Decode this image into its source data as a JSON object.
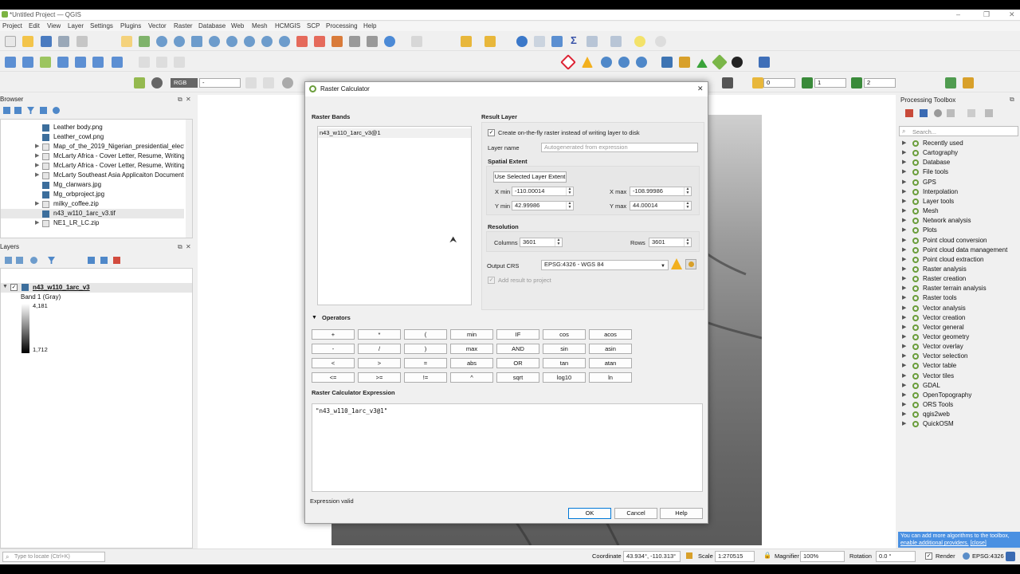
{
  "window": {
    "title": "*Untitled Project — QGIS"
  },
  "menu": [
    "Project",
    "Edit",
    "View",
    "Layer",
    "Settings",
    "Plugins",
    "Vector",
    "Raster",
    "Database",
    "Web",
    "Mesh",
    "HCMGIS",
    "SCP",
    "Processing",
    "Help"
  ],
  "toolbar3": {
    "rgb_label": "RGB",
    "rgb_value": "-",
    "val1": "0",
    "val2": "1",
    "val3": "2"
  },
  "browser": {
    "title": "Browser",
    "items": [
      "Leather body.png",
      "Leather_cowl.png",
      "Map_of_the_2019_Nigerian_presidential_electio",
      "McLarty Africa - Cover Letter, Resume, Writing",
      "McLarty Africa - Cover Letter, Resume, Writing",
      "McLarty Southeast Asia Applicaiton Document",
      "Mg_clanwars.jpg",
      "Mg_orbproject.jpg",
      "milky_coffee.zip",
      "n43_w110_1arc_v3.tif",
      "NE1_LR_LC.zip"
    ]
  },
  "layers": {
    "title": "Layers",
    "layer_name": "n43_w110_1arc_v3",
    "band": "Band 1 (Gray)",
    "max": "4,181",
    "min": "1,712"
  },
  "toolbox": {
    "title": "Processing Toolbox",
    "search_placeholder": "Search...",
    "items": [
      "Recently used",
      "Cartography",
      "Database",
      "File tools",
      "GPS",
      "Interpolation",
      "Layer tools",
      "Mesh",
      "Network analysis",
      "Plots",
      "Point cloud conversion",
      "Point cloud data management",
      "Point cloud extraction",
      "Raster analysis",
      "Raster creation",
      "Raster terrain analysis",
      "Raster tools",
      "Vector analysis",
      "Vector creation",
      "Vector general",
      "Vector geometry",
      "Vector overlay",
      "Vector selection",
      "Vector table",
      "Vector tiles",
      "GDAL",
      "OpenTopography",
      "ORS Tools",
      "qgis2web",
      "QuickOSM"
    ],
    "tip": "You can add more algorithms to the toolbox,",
    "tip_link": "enable additional providers.",
    "tip_close": "[close]"
  },
  "dialog": {
    "title": "Raster Calculator",
    "raster_bands_label": "Raster Bands",
    "band_item": "n43_w110_1arc_v3@1",
    "result_layer_label": "Result Layer",
    "onfly_label": "Create on-the-fly raster instead of writing layer to disk",
    "layer_name_label": "Layer name",
    "layer_name_placeholder": "Autogenerated from expression",
    "spatial_extent_label": "Spatial Extent",
    "use_extent_button": "Use Selected Layer Extent",
    "xmin_label": "X min",
    "xmin": "-110.00014",
    "xmax_label": "X max",
    "xmax": "-108.99986",
    "ymin_label": "Y min",
    "ymin": "42.99986",
    "ymax_label": "Y max",
    "ymax": "44.00014",
    "resolution_label": "Resolution",
    "columns_label": "Columns",
    "columns": "3601",
    "rows_label": "Rows",
    "rows": "3601",
    "crs_label": "Output CRS",
    "crs": "EPSG:4326 - WGS 84",
    "add_result_label": "Add result to project",
    "operators_label": "Operators",
    "operators": [
      [
        "+",
        "*",
        "(",
        "min",
        "IF",
        "cos",
        "acos"
      ],
      [
        "-",
        "/",
        ")",
        "max",
        "AND",
        "sin",
        "asin"
      ],
      [
        "<",
        ">",
        "=",
        "abs",
        "OR",
        "tan",
        "atan"
      ],
      [
        "<=",
        ">=",
        "!=",
        "^",
        "sqrt",
        "log10",
        "ln"
      ]
    ],
    "expression_label": "Raster Calculator Expression",
    "expression": "\"n43_w110_1arc_v3@1\"",
    "status": "Expression valid",
    "ok": "OK",
    "cancel": "Cancel",
    "help": "Help"
  },
  "status": {
    "locate_placeholder": "Type to locate (Ctrl+K)",
    "coordinate_label": "Coordinate",
    "coordinate": "43.934°, -110.313°",
    "scale_label": "Scale",
    "scale": "1:270515",
    "magnifier_label": "Magnifier",
    "magnifier": "100%",
    "rotation_label": "Rotation",
    "rotation": "0.0 °",
    "render_label": "Render",
    "crs": "EPSG:4326"
  },
  "colors": {
    "accent": "#0078d7",
    "dem_dark": "#3a3a3a",
    "warning": "#f2b01e"
  }
}
